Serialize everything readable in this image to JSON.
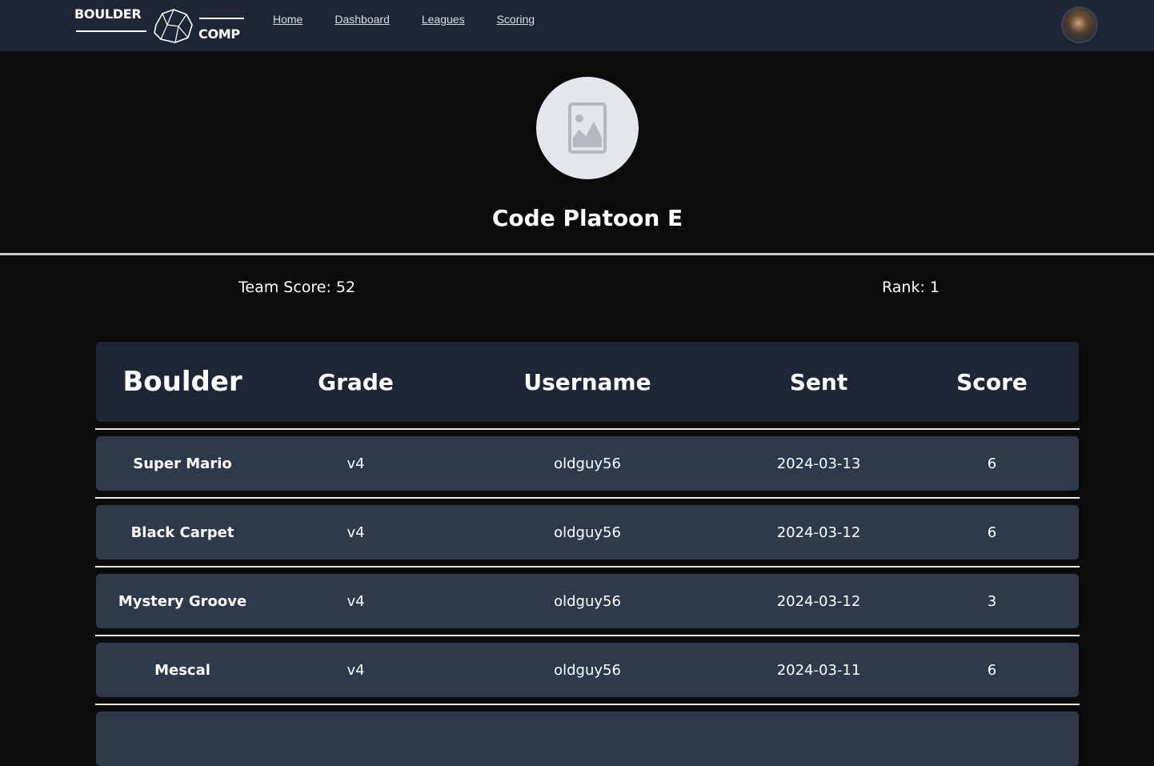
{
  "brand": {
    "logo_top": "BOULDER",
    "logo_bottom": "COMP"
  },
  "nav": {
    "links": [
      "Home",
      "Dashboard",
      "Leagues",
      "Scoring"
    ]
  },
  "team": {
    "name": "Code Platoon E",
    "score_text": "Team Score: 52",
    "rank_text": "Rank: 1"
  },
  "table": {
    "headers": [
      "Boulder",
      "Grade",
      "Username",
      "Sent",
      "Score"
    ],
    "rows": [
      [
        "Super Mario",
        "v4",
        "oldguy56",
        "2024-03-13",
        "6"
      ],
      [
        "Black Carpet",
        "v4",
        "oldguy56",
        "2024-03-12",
        "6"
      ],
      [
        "Mystery Groove",
        "v4",
        "oldguy56",
        "2024-03-12",
        "3"
      ],
      [
        "Mescal",
        "v4",
        "oldguy56",
        "2024-03-11",
        "6"
      ]
    ]
  },
  "colors": {
    "navbar": "#1e2636",
    "page_bg": "#0b0b0b",
    "row_bg": "#2e3a4c",
    "header_bg": "#1e2636"
  }
}
